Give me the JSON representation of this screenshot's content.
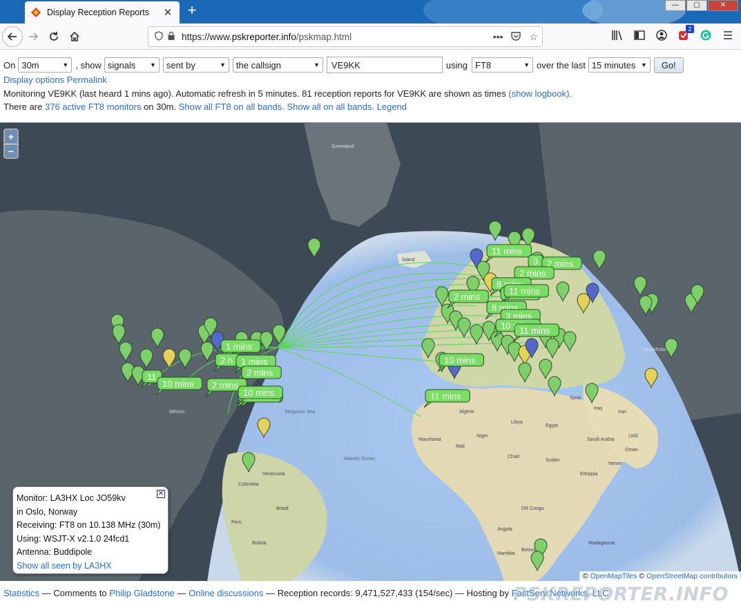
{
  "browser": {
    "tab_title": "Display Reception Reports",
    "url_prefix": "https://www.",
    "url_host": "pskreporter.info",
    "url_path": "/pskmap.html",
    "extension_badge": "2"
  },
  "controls": {
    "on_label": "On",
    "band": "30m",
    "show_label": ", show",
    "show": "signals",
    "direction": "sent by",
    "target": "the callsign",
    "callsign": "VE9KK",
    "using_label": "using",
    "mode": "FT8",
    "over_label": "over the last",
    "period": "15 minutes",
    "go": "Go!"
  },
  "links": {
    "display_options": "Display options",
    "permalink": "Permalink"
  },
  "status": {
    "monitoring": "Monitoring VE9KK (last heard 1 mins ago). Automatic refresh in 5 minutes. 81 reception reports for VE9KK are shown as times",
    "show_logbook": "(show logbook).",
    "there_are": "There are",
    "active_monitors": "376 active FT8 monitors",
    "on_band": "on 30m.",
    "show_all_ft8": "Show all FT8 on all bands.",
    "show_all": "Show all on all bands.",
    "legend": "Legend"
  },
  "map": {
    "zoom_in": "+",
    "zoom_out": "−",
    "labels": {
      "greenland": "Greenland",
      "iceland": "Ísland",
      "atlantic": "Atlantic Ocean",
      "sargasso": "Sargasso Sea",
      "mauritania": "Mauritania",
      "mali": "Mali",
      "niger": "Niger",
      "chad": "Chad",
      "algerie": "Algérie",
      "egypt": "Egypt",
      "libya": "Libya",
      "sudan": "Sudan",
      "ethiopia": "Ethiopia",
      "drc": "DR Congo",
      "angola": "Angola",
      "namibia": "Namibia",
      "botswana": "Botswana",
      "madagascar": "Madagascar",
      "brasil": "Brasil",
      "bolivia": "Bolivia",
      "peru": "Perú",
      "venezuela": "Venezuela",
      "colombia": "Colombia",
      "mexico": "México",
      "saudi": "Saudi Arabia",
      "oman": "Oman",
      "yemen": "Yemen",
      "iran": "Iran",
      "uae": "UAE",
      "iraq": "Iraq",
      "syria": "Syria",
      "kazakhstan": "Kazakhstan"
    },
    "time_labels": [
      "11 mins",
      "3",
      "2 mins",
      "2 mins",
      "8 mins",
      "8 mins",
      "11 mins",
      "2 mins",
      "8 mins",
      "3 mins",
      "10 mins",
      "11 mins",
      "10 mins",
      "11 mins",
      "1 mins",
      "2 n",
      "1 mins",
      "2 mins",
      "11",
      "10 mins",
      "2 mins",
      "10 mins",
      "1 mins",
      "10 mins"
    ]
  },
  "infobox": {
    "monitor": "Monitor: LA3HX Loc JO59kv",
    "location": "in Oslo, Norway",
    "receiving": "Receiving: FT8 on 10.138 MHz (30m)",
    "using": "Using: WSJT-X v2.1.0 24fcd1",
    "antenna": "Antenna: Buddipole",
    "show_all": "Show all seen by LA3HX"
  },
  "attribution": {
    "copy": "©",
    "omt": "OpenMapTiles",
    "osm": "OpenStreetMap contributors"
  },
  "footer": {
    "statistics": "Statistics",
    "comments": "— Comments to",
    "author": "Philip Gladstone",
    "sep1": "—",
    "discussions": "Online discussions",
    "records": "— Reception records: 9,471,527,433 (154/sec) — Hosting by",
    "hosting": "FastServ Networks, LLC"
  },
  "watermark": "PSKREPORTER.INFO"
}
